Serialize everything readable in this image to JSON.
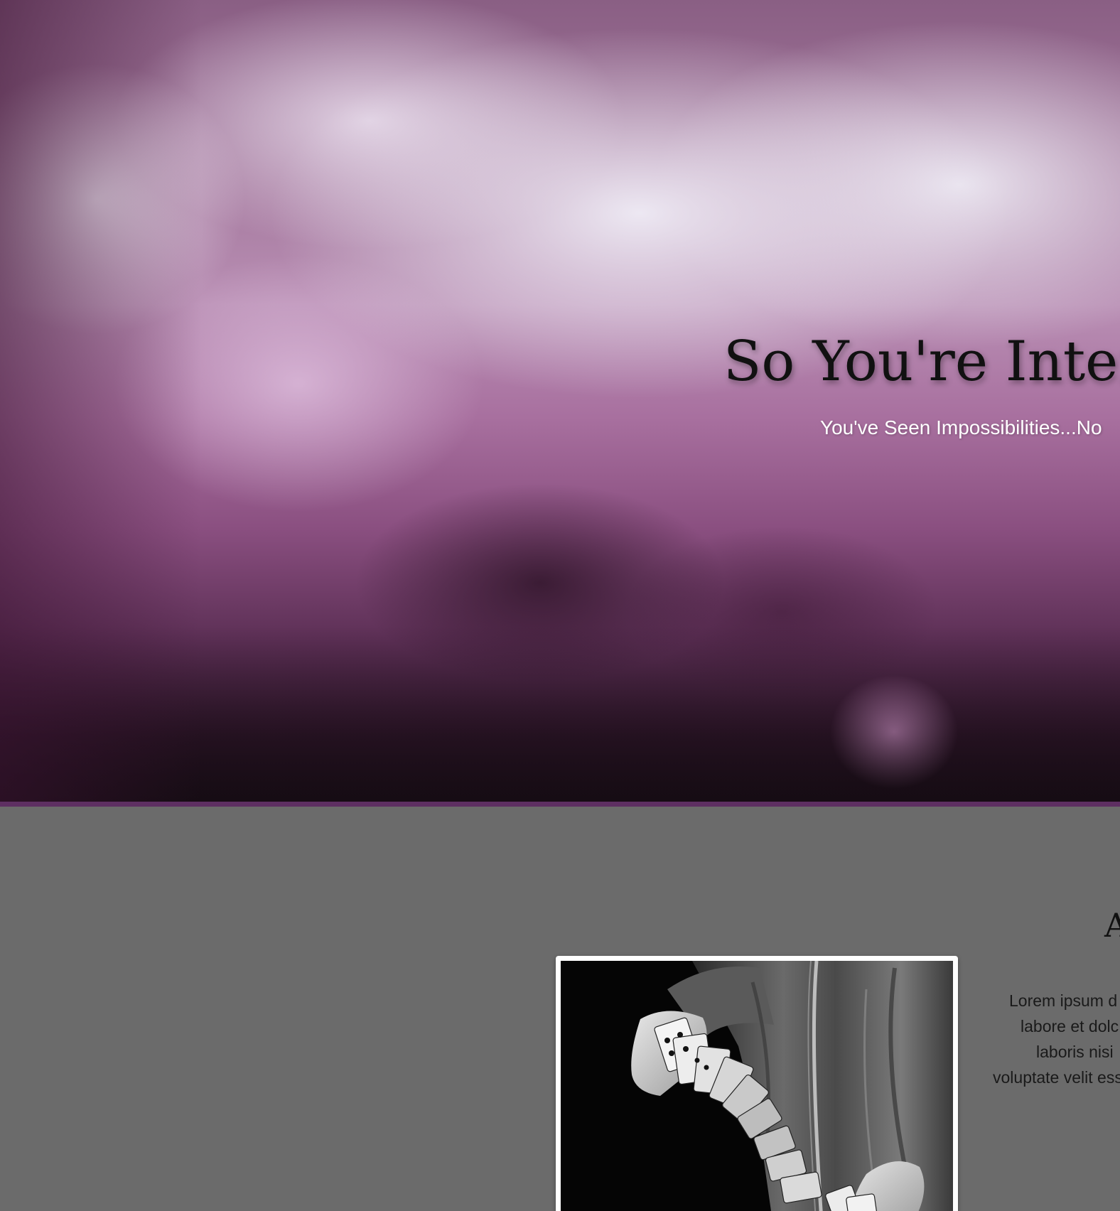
{
  "hero": {
    "title": "So You're Inter",
    "subtitle": "You've Seen Impossibilities...No"
  },
  "about": {
    "heading": "A",
    "photo_alt": "Magician fanning playing cards from one hand to the other",
    "paragraph_lines": [
      "Lorem ipsum d",
      "labore et dolc",
      "laboris nisi",
      "voluptate velit ess"
    ]
  },
  "colors": {
    "accent_rule": "#5e2f62",
    "section_bg": "#6b6b6b",
    "title_text": "#111111",
    "subtitle_text": "#ffffff"
  }
}
